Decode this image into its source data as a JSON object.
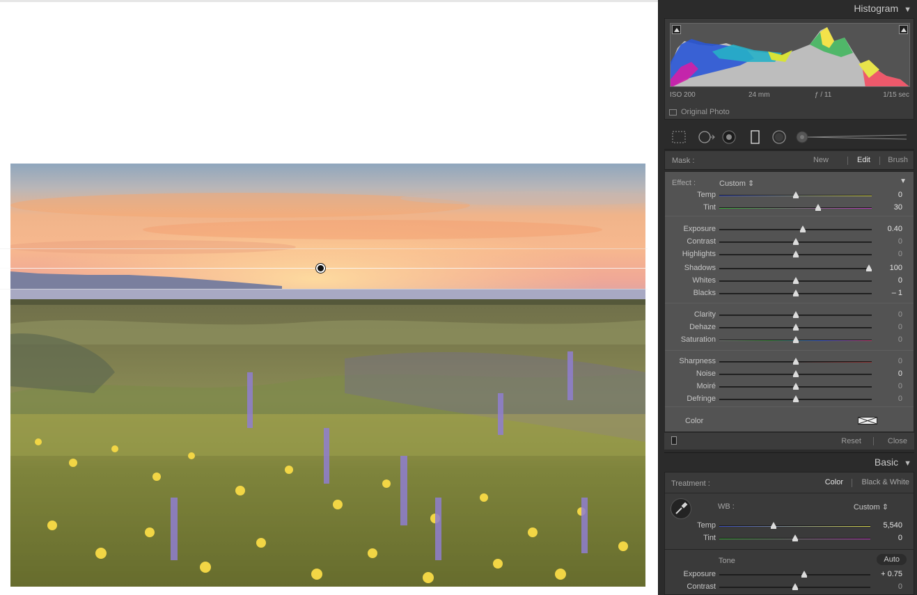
{
  "histogram": {
    "title": "Histogram",
    "iso": "ISO 200",
    "focal": "24 mm",
    "aperture": "ƒ / 11",
    "shutter": "1/15 sec",
    "original_photo": "Original Photo"
  },
  "mask": {
    "label": "Mask :",
    "new": "New",
    "edit": "Edit",
    "brush": "Brush"
  },
  "effect": {
    "label": "Effect :",
    "preset": "Custom",
    "sliders": [
      {
        "name": "Temp",
        "value": "0",
        "pos": 0.5
      },
      {
        "name": "Tint",
        "value": "30",
        "pos": 0.65
      },
      {
        "name": "Exposure",
        "value": "0.40",
        "pos": 0.55
      },
      {
        "name": "Contrast",
        "value": "0",
        "pos": 0.5
      },
      {
        "name": "Highlights",
        "value": "0",
        "pos": 0.5
      },
      {
        "name": "Shadows",
        "value": "100",
        "pos": 0.98
      },
      {
        "name": "Whites",
        "value": "0",
        "pos": 0.5
      },
      {
        "name": "Blacks",
        "value": "– 1",
        "pos": 0.5
      },
      {
        "name": "Clarity",
        "value": "0",
        "pos": 0.5
      },
      {
        "name": "Dehaze",
        "value": "0",
        "pos": 0.5
      },
      {
        "name": "Saturation",
        "value": "0",
        "pos": 0.5
      },
      {
        "name": "Sharpness",
        "value": "0",
        "pos": 0.5
      },
      {
        "name": "Noise",
        "value": "0",
        "pos": 0.5
      },
      {
        "name": "Moiré",
        "value": "0",
        "pos": 0.5
      },
      {
        "name": "Defringe",
        "value": "0",
        "pos": 0.5
      }
    ],
    "color_label": "Color",
    "reset": "Reset",
    "close": "Close"
  },
  "basic": {
    "title": "Basic",
    "treatment_label": "Treatment :",
    "color": "Color",
    "bw": "Black & White",
    "wb_label": "WB :",
    "wb_value": "Custom",
    "temp": {
      "name": "Temp",
      "value": "5,540",
      "pos": 0.36
    },
    "tint": {
      "name": "Tint",
      "value": "0",
      "pos": 0.5
    },
    "tone_label": "Tone",
    "auto": "Auto",
    "exposure": {
      "name": "Exposure",
      "value": "+ 0.75",
      "pos": 0.56
    },
    "contrast": {
      "name": "Contrast",
      "value": "0",
      "pos": 0.5
    }
  },
  "colors": {
    "panel_bg": "#2b2b2b",
    "effect_bg": "#535353"
  }
}
